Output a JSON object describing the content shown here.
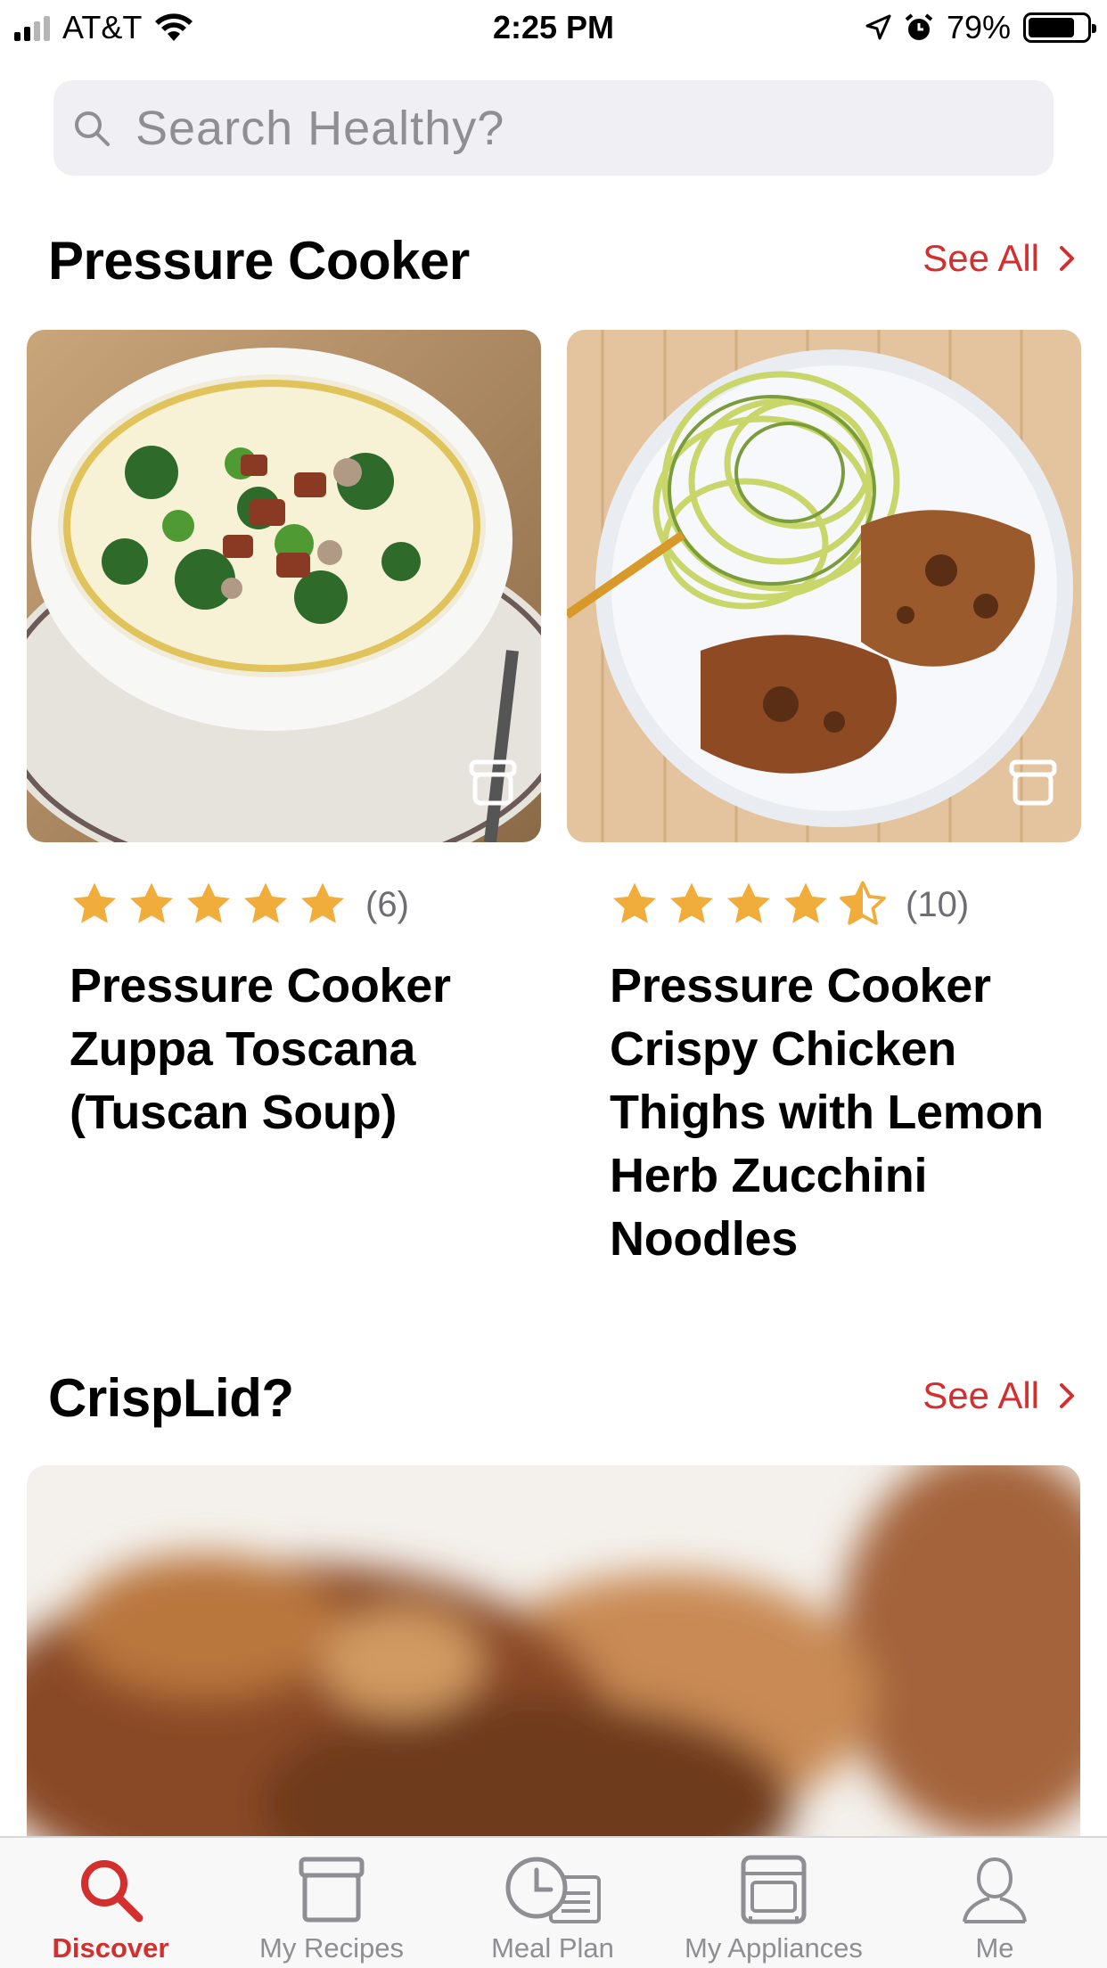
{
  "status_bar": {
    "carrier": "AT&T",
    "time": "2:25 PM",
    "battery_percent": "79%",
    "battery_level": 0.79,
    "icons": [
      "signal-icon",
      "wifi-icon",
      "location-icon",
      "alarm-icon",
      "battery-icon"
    ]
  },
  "search": {
    "placeholder": "Search Healthy?"
  },
  "sections": [
    {
      "title": "Pressure Cooker",
      "see_all": "See All",
      "recipes": [
        {
          "title": "Pressure Cooker Zuppa Toscana (Tuscan Soup)",
          "rating": 5,
          "rating_count": "(6)"
        },
        {
          "title": "Pressure Cooker Crispy Chicken Thighs with Lemon Herb Zucchini Noodles",
          "rating": 4.5,
          "rating_count": "(10)"
        }
      ]
    },
    {
      "title": "CrispLid?",
      "see_all": "See All"
    }
  ],
  "tab_bar": {
    "tabs": [
      {
        "label": "Discover",
        "icon": "search-icon",
        "active": true
      },
      {
        "label": "My Recipes",
        "icon": "recipe-box-icon",
        "active": false
      },
      {
        "label": "Meal Plan",
        "icon": "meal-plan-icon",
        "active": false
      },
      {
        "label": "My Appliances",
        "icon": "appliance-icon",
        "active": false
      },
      {
        "label": "Me",
        "icon": "profile-icon",
        "active": false
      }
    ]
  },
  "colors": {
    "accent": "#d32f2f",
    "star": "#f0ad3c",
    "search_bg": "#efeff4",
    "muted_text": "#8e8e93"
  }
}
